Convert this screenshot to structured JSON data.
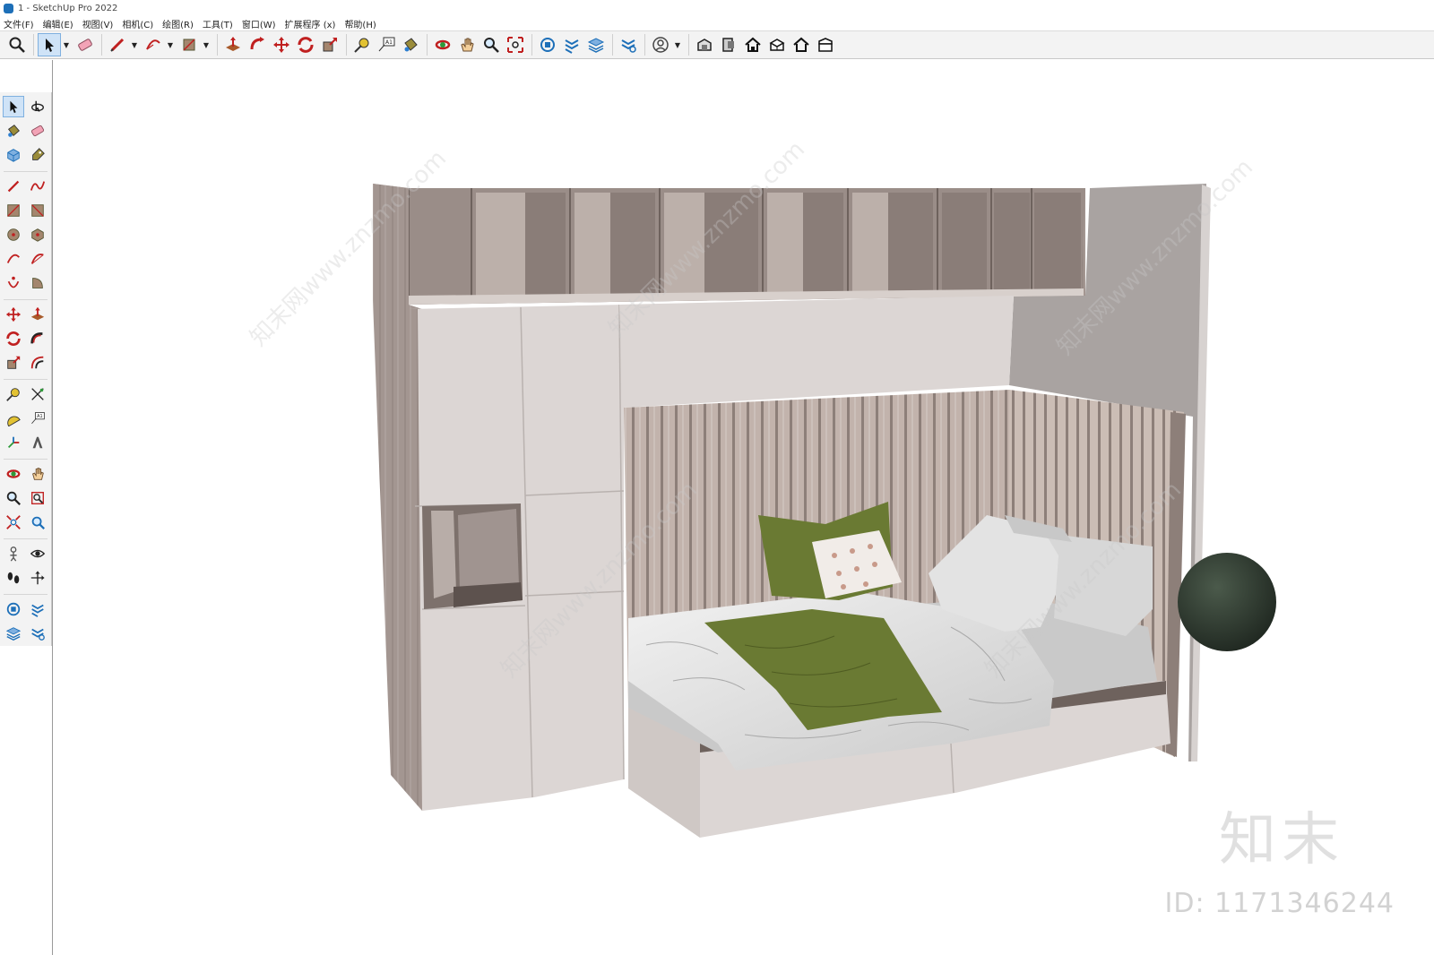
{
  "window": {
    "title": "1 - SketchUp Pro 2022"
  },
  "menu": [
    "文件(F)",
    "编辑(E)",
    "视图(V)",
    "相机(C)",
    "绘图(R)",
    "工具(T)",
    "窗口(W)",
    "扩展程序 (x)",
    "帮助(H)"
  ],
  "toolbar": {
    "buttons": [
      "zoom-extents",
      "select",
      "eraser",
      "line",
      "arc",
      "rectangle",
      "push-pull",
      "follow-me",
      "move",
      "rotate",
      "scale",
      "tape-measure",
      "text",
      "paint-bucket",
      "orbit",
      "pan",
      "zoom",
      "zoom-window",
      "component",
      "section",
      "layers",
      "tags",
      "profile",
      "warehouse",
      "extension-warehouse",
      "house",
      "house-3d",
      "house-outline",
      "house-box"
    ]
  },
  "left_toolbar": {
    "rows": [
      [
        "select",
        "orbit"
      ],
      [
        "paint-bucket",
        "eraser"
      ],
      [
        "component",
        "tag-paint"
      ],
      [
        "line",
        "freehand"
      ],
      [
        "rectangle",
        "rotated-rectangle"
      ],
      [
        "circle",
        "polygon"
      ],
      [
        "arc",
        "two-point-arc"
      ],
      [
        "three-point-arc",
        "pie"
      ],
      [
        "move",
        "push-pull"
      ],
      [
        "rotate",
        "follow-me"
      ],
      [
        "scale",
        "offset"
      ],
      [
        "tape-measure",
        "dimension"
      ],
      [
        "protractor",
        "text"
      ],
      [
        "axes",
        "3d-text"
      ],
      [
        "orbit-tool",
        "pan-tool"
      ],
      [
        "zoom-tool",
        "zoom-window-tool"
      ],
      [
        "zoom-extents-tool",
        "previous-view"
      ],
      [
        "position-camera",
        "look-around"
      ],
      [
        "walk",
        "section-plane"
      ],
      [
        "warehouse-left",
        "extension-left"
      ],
      [
        "layers-left",
        "settings-left"
      ]
    ]
  },
  "watermark": {
    "logo_text": "知末",
    "id_text": "ID: 1171346244",
    "diagonal_text": "知末网www.znzmo.com"
  },
  "colors": {
    "cabinet_white": "#dcd6d4",
    "wood": "#a09490",
    "wall": "#a9a3a1",
    "blanket_green": "#6a7a33",
    "sphere": "#2f3a30"
  }
}
